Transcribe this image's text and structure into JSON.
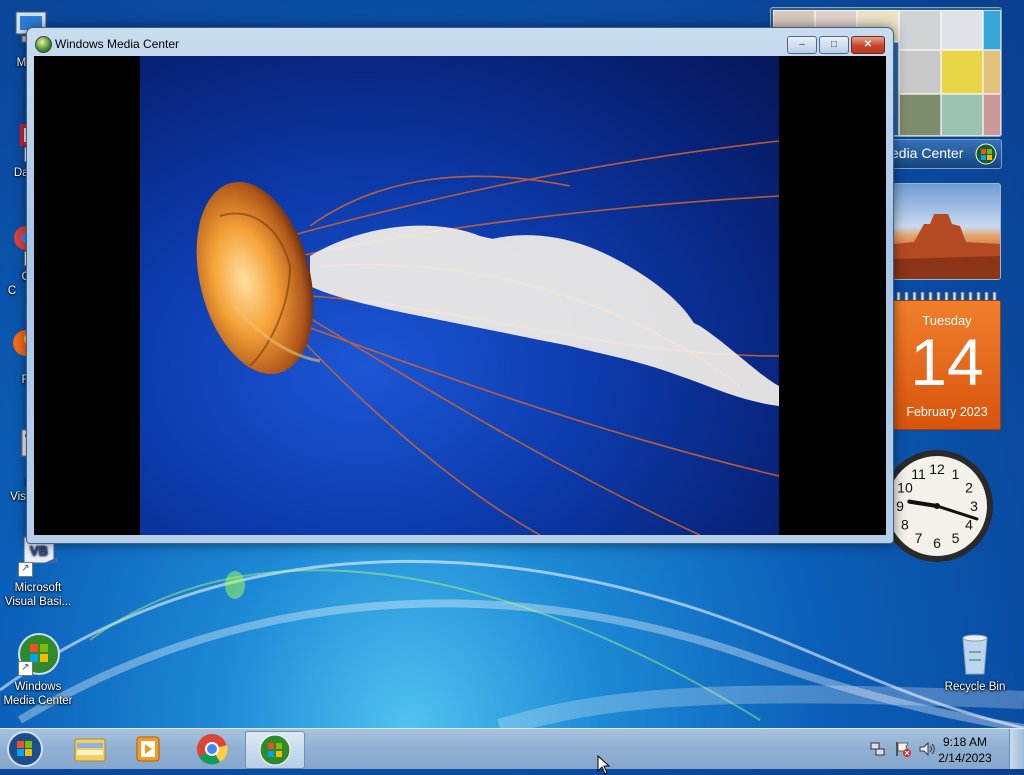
{
  "window": {
    "title": "Windows Media Center",
    "minimize_symbol": "–",
    "restore_symbol": "□",
    "close_symbol": "✕"
  },
  "desktop_icons": [
    {
      "name": "my-computer",
      "label": "My C"
    },
    {
      "name": "data",
      "label": "Data"
    },
    {
      "name": "g",
      "label": "G\nC"
    },
    {
      "name": "f",
      "label": "F"
    },
    {
      "name": "m",
      "label": "M\nVis"
    },
    {
      "name": "visual-basic",
      "label": "Microsoft Visual Basi..."
    },
    {
      "name": "windows-media-center",
      "label": "Windows Media Center"
    },
    {
      "name": "recycle-bin",
      "label": "Recycle Bin"
    }
  ],
  "gadgets": {
    "media_center_banner": "edia Center",
    "calendar": {
      "weekday": "Tuesday",
      "day": "14",
      "month_year": "February 2023"
    },
    "clock": {
      "hour": 9,
      "minute": 18,
      "numbers": [
        "12",
        "1",
        "2",
        "3",
        "4",
        "5",
        "6",
        "7",
        "8",
        "9",
        "10",
        "11"
      ]
    }
  },
  "taskbar": {
    "time": "9:18 AM",
    "date": "2/14/2023",
    "pinned": [
      "start-button",
      "file-explorer",
      "media-player",
      "chrome",
      "windows-media-center"
    ]
  },
  "colors": {
    "desktop_blue": "#0b5fb8",
    "taskbar": "#8fb0d3",
    "calendar_orange": "#e8681a"
  }
}
